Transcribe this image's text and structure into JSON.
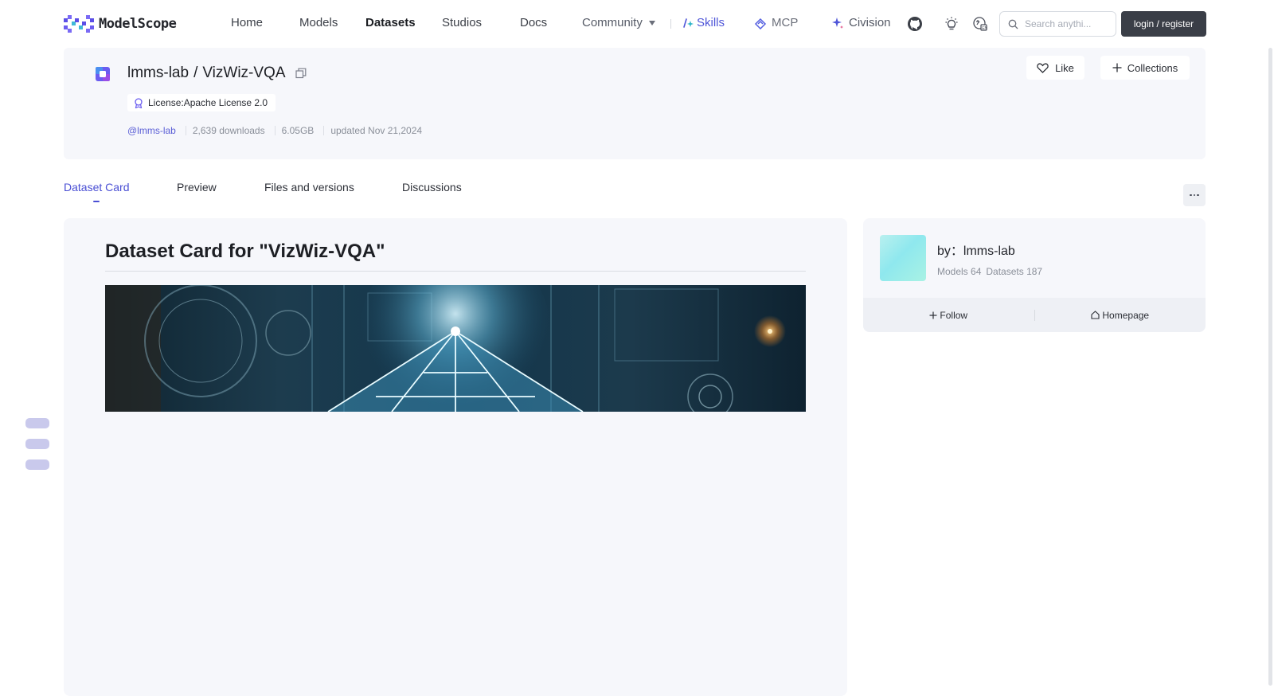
{
  "brand": {
    "name": "ModelScope"
  },
  "nav": {
    "home": "Home",
    "models": "Models",
    "datasets": "Datasets",
    "studios": "Studios",
    "docs": "Docs",
    "community": "Community",
    "skills": "Skills",
    "mcp": "MCP",
    "civision": "Civision"
  },
  "search": {
    "placeholder": "Search anythi..."
  },
  "auth": {
    "login_label": "login / register"
  },
  "dataset": {
    "owner": "lmms-lab",
    "separator": "/",
    "name": "VizWiz-VQA",
    "license": "License:Apache License 2.0",
    "owner_handle": "@lmms-lab",
    "downloads": "2,639 downloads",
    "size": "6.05GB",
    "updated": "updated Nov 21,2024",
    "like_label": "Like",
    "collections_label": "Collections"
  },
  "tabs": {
    "card": "Dataset Card",
    "preview": "Preview",
    "files": "Files and versions",
    "discussions": "Discussions"
  },
  "card": {
    "title": "Dataset Card for \"VizWiz-VQA\""
  },
  "author": {
    "by": "by：lmms-lab",
    "models": "Models 64",
    "datasets": "Datasets 187",
    "follow": "Follow",
    "homepage": "Homepage"
  },
  "colors": {
    "accent": "#4a4fd4",
    "dark_button": "#3a3e47",
    "panel": "#f6f7fb"
  }
}
